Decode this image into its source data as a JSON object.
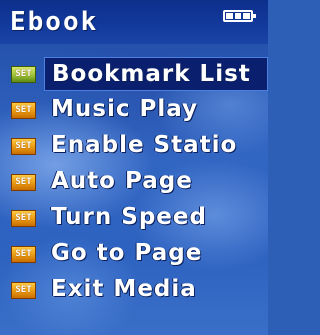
{
  "header": {
    "title": "Ebook",
    "battery_icon": "battery-icon"
  },
  "menu": {
    "items": [
      {
        "label": "Bookmark List",
        "icon": "set-icon",
        "icon_text": "SET",
        "selected": true
      },
      {
        "label": "Music Play",
        "icon": "set-icon",
        "icon_text": "SET",
        "selected": false
      },
      {
        "label": "Enable Statio",
        "icon": "set-icon",
        "icon_text": "SET",
        "selected": false
      },
      {
        "label": "Auto Page",
        "icon": "set-icon",
        "icon_text": "SET",
        "selected": false
      },
      {
        "label": "Turn Speed",
        "icon": "set-icon",
        "icon_text": "SET",
        "selected": false
      },
      {
        "label": "Go to Page",
        "icon": "set-icon",
        "icon_text": "SET",
        "selected": false
      },
      {
        "label": "Exit Media",
        "icon": "set-icon",
        "icon_text": "SET",
        "selected": false
      }
    ]
  },
  "colors": {
    "title_bar": "#0d2f8c",
    "selection": "#0a1f6e",
    "icon_orange": "#e89a14",
    "icon_green": "#9ec23a",
    "text": "#ffffff"
  }
}
